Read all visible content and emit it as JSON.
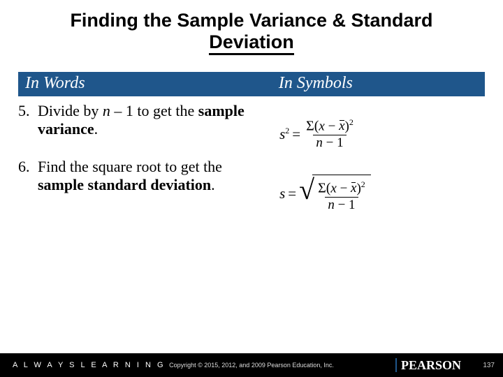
{
  "title_line1": "Finding the Sample Variance & Standard",
  "title_line2": "Deviation",
  "header": {
    "words": "In Words",
    "symbols": "In Symbols"
  },
  "steps": [
    {
      "num": "5.",
      "pre": "Divide by ",
      "ital": "n",
      "mid": " – 1 to get the ",
      "bold": "sample variance",
      "post": "."
    },
    {
      "num": "6.",
      "pre": "Find the square root to get the ",
      "ital": "",
      "mid": "",
      "bold": "sample standard deviation",
      "post": "."
    }
  ],
  "formula": {
    "lhs1": "s",
    "sup1": "2",
    "eq": " = ",
    "sum_open": "Σ(",
    "x": "x",
    "minus": " − ",
    "xbar": "x",
    "close": ")",
    "sup2": "2",
    "denom_n": "n",
    "denom_rest": " − 1",
    "lhs2": "s"
  },
  "footer": {
    "always": "A L W A Y S   L E A R N I N G",
    "copy": "Copyright © 2015, 2012, and 2009 Pearson Education, Inc.",
    "brand": "PEARSON",
    "page": "137"
  }
}
